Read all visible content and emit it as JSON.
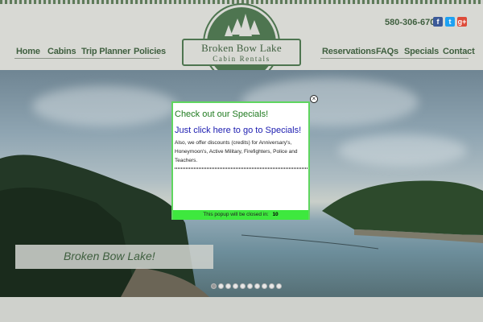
{
  "header": {
    "phone": "580-306-6700",
    "social": [
      {
        "name": "facebook-icon",
        "glyph": "f",
        "color": "#3b5998"
      },
      {
        "name": "twitter-icon",
        "glyph": "t",
        "color": "#1da1f2"
      },
      {
        "name": "google-plus-icon",
        "glyph": "g+",
        "color": "#dd4b39"
      }
    ]
  },
  "nav": {
    "left": [
      "Home",
      "Cabins",
      "Trip Planner",
      "Policies"
    ],
    "right": [
      "Reservations",
      "FAQs",
      "Specials",
      "Contact"
    ]
  },
  "logo": {
    "title": "Broken Bow Lake",
    "subtitle": "Cabin Rentals"
  },
  "hero": {
    "caption": "Broken Bow Lake!",
    "slide_count": 10,
    "active_slide": 1
  },
  "popup": {
    "heading": "Check out our Specials!",
    "link": "Just click here to go to Specials!",
    "body": "Also, we offer discounts (credits) for Anniversary's, Honeymoon's, Active Military, Firefighters, Police and Teachers.",
    "footer_text": "This popup will be closed in:",
    "countdown": "10",
    "close_glyph": "×"
  },
  "colors": {
    "brand_green": "#4e7550",
    "popup_border": "#5fd65f",
    "popup_footer": "#3ee83e",
    "link_blue": "#1b1bb0"
  }
}
